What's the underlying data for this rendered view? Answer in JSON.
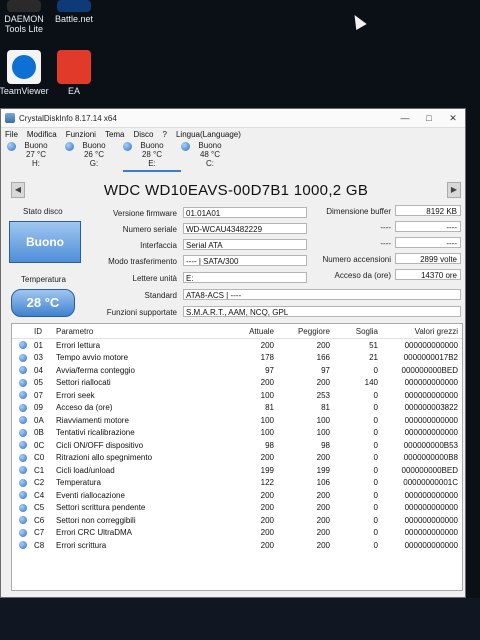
{
  "desktop": {
    "icons": [
      {
        "label": "DAEMON\nTools Lite",
        "color": "#2a2a2a"
      },
      {
        "label": "Battle.net",
        "color": "#0e3a78"
      },
      {
        "label": "TeamViewer",
        "color": "#0e6fd4"
      },
      {
        "label": "EA",
        "color": "#e23a2a"
      }
    ]
  },
  "window": {
    "title": "CrystalDiskInfo 8.17.14 x64",
    "menu": [
      "File",
      "Modifica",
      "Funzioni",
      "Tema",
      "Disco",
      "?",
      "Lingua(Language)"
    ],
    "drives": [
      {
        "status": "Buono",
        "temp": "27 °C",
        "letter": "H:"
      },
      {
        "status": "Buono",
        "temp": "26 °C",
        "letter": "G:"
      },
      {
        "status": "Buono",
        "temp": "28 °C",
        "letter": "E:"
      },
      {
        "status": "Buono",
        "temp": "48 °C",
        "letter": "C:"
      }
    ],
    "model": "WDC WD10EAVS-00D7B1 1000,2 GB",
    "status_label": "Stato disco",
    "health": "Buono",
    "temp_label": "Temperatura",
    "temperature": "28 °C",
    "info": {
      "firmware_label": "Versione firmware",
      "firmware": "01.01A01",
      "serial_label": "Numero seriale",
      "serial": "WD-WCAU43482229",
      "interface_label": "Interfaccia",
      "interface": "Serial ATA",
      "transfer_label": "Modo trasferimento",
      "transfer": "---- | SATA/300",
      "drive_letter_label": "Lettere unità",
      "drive_letter": "E:",
      "standard_label": "Standard",
      "standard": "ATA8-ACS | ----",
      "features_label": "Funzioni supportate",
      "features": "S.M.A.R.T., AAM, NCQ, GPL",
      "buffer_label": "Dimensione buffer",
      "buffer": "8192 KB",
      "dash1_label": "----",
      "dash1": "----",
      "dash2_label": "----",
      "dash2": "----",
      "power_on_count_label": "Numero accensioni",
      "power_on_count": "2899 volte",
      "power_on_hours_label": "Acceso da (ore)",
      "power_on_hours": "14370 ore"
    },
    "smart_headers": {
      "id": "ID",
      "name": "Parametro",
      "current": "Attuale",
      "worst": "Peggiore",
      "threshold": "Soglia",
      "raw": "Valori grezzi"
    },
    "smart": [
      {
        "id": "01",
        "name": "Errori lettura",
        "current": "200",
        "worst": "200",
        "threshold": "51",
        "raw": "000000000000"
      },
      {
        "id": "03",
        "name": "Tempo avvio motore",
        "current": "178",
        "worst": "166",
        "threshold": "21",
        "raw": "0000000017B2"
      },
      {
        "id": "04",
        "name": "Avvia/ferma conteggio",
        "current": "97",
        "worst": "97",
        "threshold": "0",
        "raw": "000000000BED"
      },
      {
        "id": "05",
        "name": "Settori riallocati",
        "current": "200",
        "worst": "200",
        "threshold": "140",
        "raw": "000000000000"
      },
      {
        "id": "07",
        "name": "Errori seek",
        "current": "100",
        "worst": "253",
        "threshold": "0",
        "raw": "000000000000"
      },
      {
        "id": "09",
        "name": "Acceso da (ore)",
        "current": "81",
        "worst": "81",
        "threshold": "0",
        "raw": "000000003822"
      },
      {
        "id": "0A",
        "name": "Riavviamenti motore",
        "current": "100",
        "worst": "100",
        "threshold": "0",
        "raw": "000000000000"
      },
      {
        "id": "0B",
        "name": "Tentativi ricalibrazione",
        "current": "100",
        "worst": "100",
        "threshold": "0",
        "raw": "000000000000"
      },
      {
        "id": "0C",
        "name": "Cicli ON/OFF dispositivo",
        "current": "98",
        "worst": "98",
        "threshold": "0",
        "raw": "000000000B53"
      },
      {
        "id": "C0",
        "name": "Ritrazioni allo spegnimento",
        "current": "200",
        "worst": "200",
        "threshold": "0",
        "raw": "0000000000B8"
      },
      {
        "id": "C1",
        "name": "Cicli load/unload",
        "current": "199",
        "worst": "199",
        "threshold": "0",
        "raw": "000000000BED"
      },
      {
        "id": "C2",
        "name": "Temperatura",
        "current": "122",
        "worst": "106",
        "threshold": "0",
        "raw": "00000000001C"
      },
      {
        "id": "C4",
        "name": "Eventi riallocazione",
        "current": "200",
        "worst": "200",
        "threshold": "0",
        "raw": "000000000000"
      },
      {
        "id": "C5",
        "name": "Settori scrittura pendente",
        "current": "200",
        "worst": "200",
        "threshold": "0",
        "raw": "000000000000"
      },
      {
        "id": "C6",
        "name": "Settori non correggibili",
        "current": "200",
        "worst": "200",
        "threshold": "0",
        "raw": "000000000000"
      },
      {
        "id": "C7",
        "name": "Errori CRC UltraDMA",
        "current": "200",
        "worst": "200",
        "threshold": "0",
        "raw": "000000000000"
      },
      {
        "id": "C8",
        "name": "Errori scrittura",
        "current": "200",
        "worst": "200",
        "threshold": "0",
        "raw": "000000000000"
      }
    ]
  }
}
